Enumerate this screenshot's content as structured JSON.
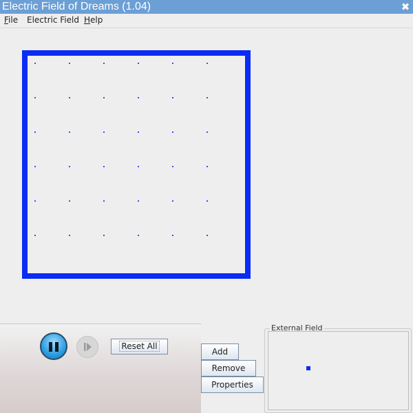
{
  "window": {
    "title": "Electric Field of Dreams (1.04)",
    "close_icon": "close-icon"
  },
  "menubar": {
    "items": [
      {
        "label_mnemonic": "F",
        "label_rest": "ile"
      },
      {
        "label_mnemonic": "",
        "label_rest": "Electric Field"
      },
      {
        "label_mnemonic": "H",
        "label_rest": "elp"
      }
    ]
  },
  "field": {
    "box_color": "#0a2cf5",
    "grid_rows": 6,
    "grid_cols": 6,
    "dot_color": "#3a4cff"
  },
  "controls": {
    "pause_icon": "pause-icon",
    "step_icon": "step-icon",
    "reset_label": "Reset All",
    "add_label": "Add",
    "remove_label": "Remove",
    "properties_label": "Properties"
  },
  "external_field": {
    "legend": "External Field",
    "handle_color": "#0a2cf5"
  }
}
